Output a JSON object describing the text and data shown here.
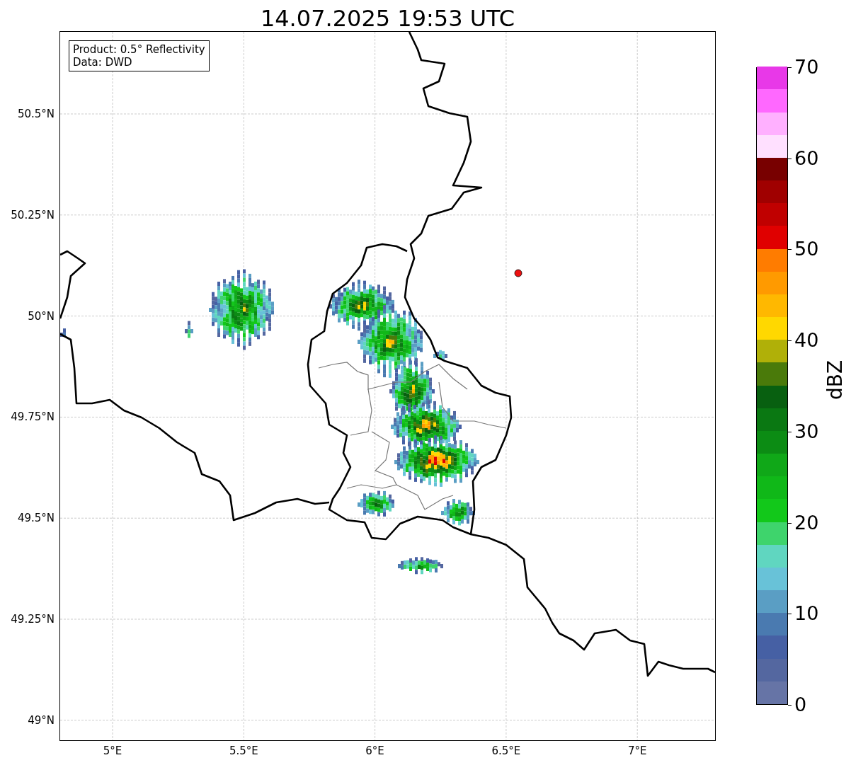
{
  "title": "14.07.2025 19:53 UTC",
  "info_box": [
    "Product: 0.5° Reflectivity",
    "Data: DWD"
  ],
  "map": {
    "latitude_ticks": [
      "50.5°N",
      "50.25°N",
      "50°N",
      "49.75°N",
      "49.5°N",
      "49.25°N",
      "49°N"
    ],
    "longitude_ticks": [
      "5°E",
      "5.5°E",
      "6°E",
      "6.5°E",
      "7°E"
    ]
  },
  "colorbar": {
    "label": "dBZ",
    "ticks": [
      "70",
      "60",
      "50",
      "40",
      "30",
      "20",
      "10",
      "0"
    ],
    "bins": [
      {
        "color": "#6674a6"
      },
      {
        "color": "#5467a0"
      },
      {
        "color": "#4660a4"
      },
      {
        "color": "#4a7ab0"
      },
      {
        "color": "#5a9ec4"
      },
      {
        "color": "#68c2d8"
      },
      {
        "color": "#60d6c0"
      },
      {
        "color": "#3ed46c"
      },
      {
        "color": "#12c81a"
      },
      {
        "color": "#10b818"
      },
      {
        "color": "#10a818"
      },
      {
        "color": "#0c8c14"
      },
      {
        "color": "#0a7812"
      },
      {
        "color": "#086010"
      },
      {
        "color": "#4a7a0a"
      },
      {
        "color": "#b0b008"
      },
      {
        "color": "#ffd800"
      },
      {
        "color": "#ffb800"
      },
      {
        "color": "#ff9a00"
      },
      {
        "color": "#ff7c00"
      },
      {
        "color": "#e00000"
      },
      {
        "color": "#c00000"
      },
      {
        "color": "#a00000"
      },
      {
        "color": "#780000"
      },
      {
        "color": "#ffe0ff"
      },
      {
        "color": "#ffb0ff"
      },
      {
        "color": "#ff68ff"
      },
      {
        "color": "#e838e8"
      }
    ]
  }
}
